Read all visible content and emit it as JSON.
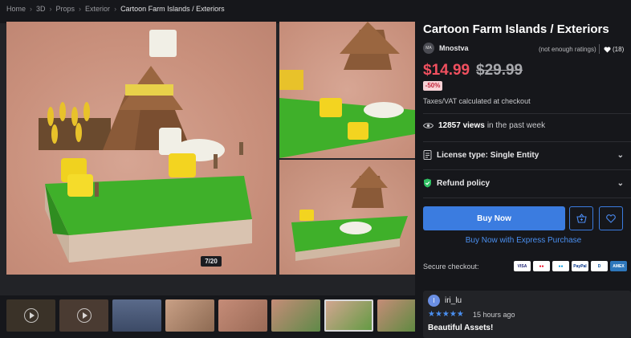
{
  "breadcrumb": [
    "Home",
    "3D",
    "Props",
    "Exterior",
    "Cartoon Farm Islands / Exteriors"
  ],
  "gallery": {
    "counter": "7/20",
    "thumbnails": 8,
    "active_thumbnail_index": 6,
    "thumb_colors": [
      "#3a3228",
      "#4a3b32",
      "#5a6a8a",
      "#a78b74",
      "#b9836b",
      "#5f8a48",
      "#c7b48f",
      "#6d8a4a"
    ]
  },
  "product": {
    "title": "Cartoon Farm Islands / Exteriors",
    "seller_avatar": "MA",
    "seller": "Mnostva",
    "ratings": "(not enough ratings)",
    "likes": "(18)",
    "price": "$14.99",
    "old_price": "$29.99",
    "discount": "-50%",
    "tax_note": "Taxes/VAT calculated at checkout",
    "views_count": "12857 views",
    "views_suffix": "in the past week",
    "license": "License type: Single Entity",
    "refund": "Refund policy",
    "buy_now": "Buy Now",
    "express": "Buy Now with Express Purchase",
    "secure_checkout": "Secure checkout:",
    "payment_cards": [
      {
        "label": "VISA",
        "bg": "#ffffff",
        "fg": "#1a1f71"
      },
      {
        "label": "●●",
        "bg": "#ffffff",
        "fg": "#eb001b"
      },
      {
        "label": "●●",
        "bg": "#ffffff",
        "fg": "#0099df"
      },
      {
        "label": "PayPal",
        "bg": "#ffffff",
        "fg": "#003087"
      },
      {
        "label": "D",
        "bg": "#ffffff",
        "fg": "#004a97"
      },
      {
        "label": "AMEX",
        "bg": "#2e77bb",
        "fg": "#ffffff"
      }
    ]
  },
  "review": {
    "avatar": "I",
    "name": "iri_lu",
    "stars": "★★★★★",
    "time": "15 hours ago",
    "title": "Beautiful Assets!"
  },
  "colors": {
    "accent": "#3b7ce0",
    "price": "#f0505f",
    "grass": "#3fa52e"
  }
}
